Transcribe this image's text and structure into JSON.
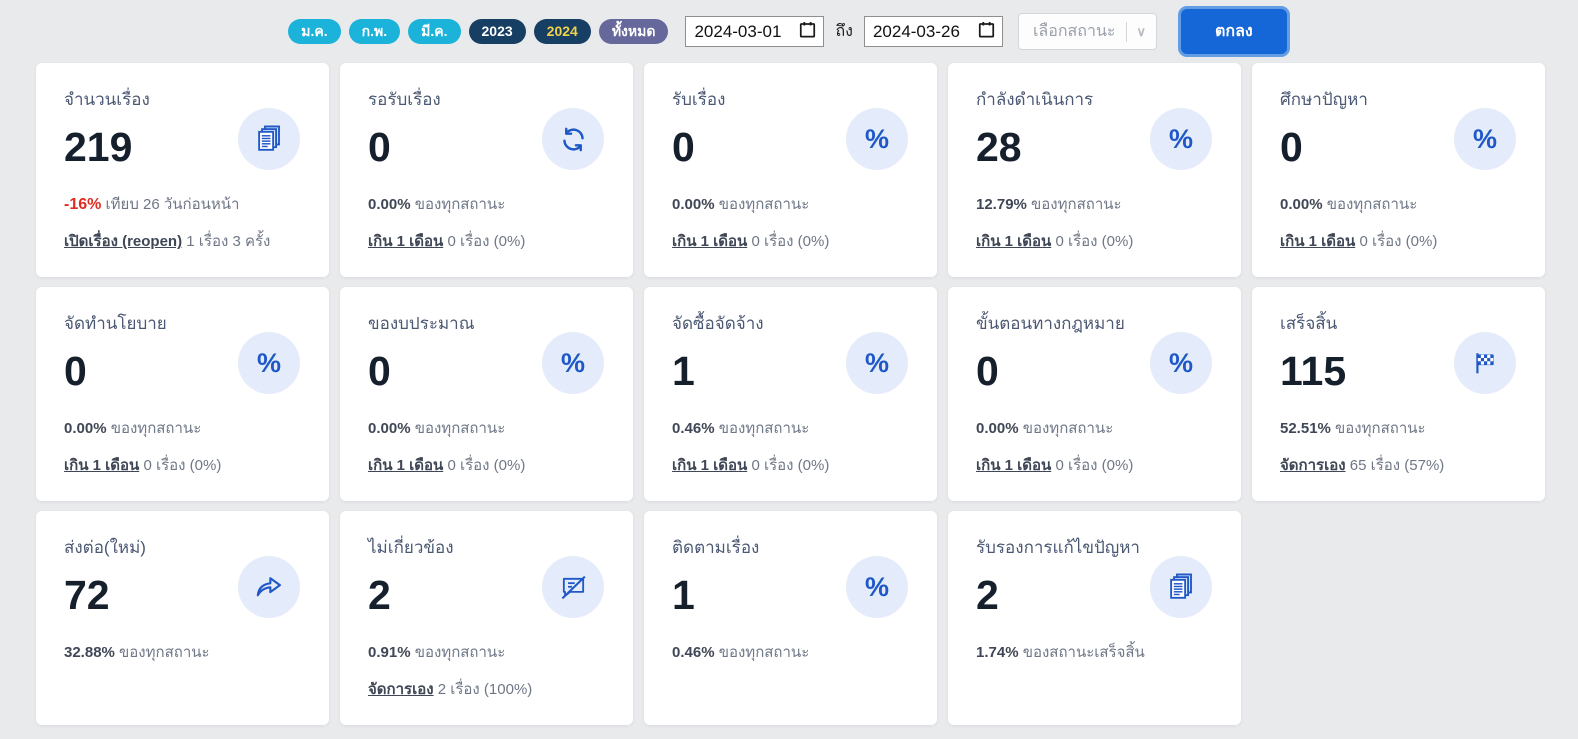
{
  "theme": {
    "page_bg": "#e9eaec",
    "card_bg": "#ffffff",
    "accent_blue": "#2058c8",
    "icon_circle_bg": "#e4ebfa",
    "chip_cyan": "#1cb3da",
    "chip_navy": "#173e63",
    "chip_active_year_text": "#f0d24b",
    "chip_purple": "#66679b",
    "button_blue": "#1566d6",
    "negative_red": "#e02b20"
  },
  "filters": {
    "chips": [
      {
        "label": "ม.ค.",
        "variant": "cyan"
      },
      {
        "label": "ก.พ.",
        "variant": "cyan"
      },
      {
        "label": "มี.ค.",
        "variant": "cyan"
      },
      {
        "label": "2023",
        "variant": "navy"
      },
      {
        "label": "2024",
        "variant": "navy-active"
      },
      {
        "label": "ทั้งหมด",
        "variant": "purple"
      }
    ],
    "date_from": "2024-03-01",
    "to_label": "ถึง",
    "date_to": "2024-03-26",
    "status_placeholder": "เลือกสถานะ",
    "submit_label": "ตกลง"
  },
  "cards": [
    {
      "title": "จำนวนเรื่อง",
      "value": "219",
      "icon": "documents-icon",
      "delta": {
        "value": "-16%",
        "suffix": "เทียบ 26 วันก่อนหน้า"
      },
      "link": {
        "label": "เปิดเรื่อง (reopen)",
        "suffix": "1 เรื่อง 3 ครั้ง"
      }
    },
    {
      "title": "รอรับเรื่อง",
      "value": "0",
      "icon": "refresh-icon",
      "percent": {
        "value": "0.00%",
        "suffix": "ของทุกสถานะ"
      },
      "link": {
        "label": "เกิน 1 เดือน",
        "suffix": "0 เรื่อง (0%)"
      }
    },
    {
      "title": "รับเรื่อง",
      "value": "0",
      "icon": "percent-icon",
      "percent": {
        "value": "0.00%",
        "suffix": "ของทุกสถานะ"
      },
      "link": {
        "label": "เกิน 1 เดือน",
        "suffix": "0 เรื่อง (0%)"
      }
    },
    {
      "title": "กำลังดำเนินการ",
      "value": "28",
      "icon": "percent-icon",
      "percent": {
        "value": "12.79%",
        "suffix": "ของทุกสถานะ"
      },
      "link": {
        "label": "เกิน 1 เดือน",
        "suffix": "0 เรื่อง (0%)"
      }
    },
    {
      "title": "ศึกษาปัญหา",
      "value": "0",
      "icon": "percent-icon",
      "percent": {
        "value": "0.00%",
        "suffix": "ของทุกสถานะ"
      },
      "link": {
        "label": "เกิน 1 เดือน",
        "suffix": "0 เรื่อง (0%)"
      }
    },
    {
      "title": "จัดทำนโยบาย",
      "value": "0",
      "icon": "percent-icon",
      "percent": {
        "value": "0.00%",
        "suffix": "ของทุกสถานะ"
      },
      "link": {
        "label": "เกิน 1 เดือน",
        "suffix": "0 เรื่อง (0%)"
      }
    },
    {
      "title": "ของบประมาณ",
      "value": "0",
      "icon": "percent-icon",
      "percent": {
        "value": "0.00%",
        "suffix": "ของทุกสถานะ"
      },
      "link": {
        "label": "เกิน 1 เดือน",
        "suffix": "0 เรื่อง (0%)"
      }
    },
    {
      "title": "จัดซื้อจัดจ้าง",
      "value": "1",
      "icon": "percent-icon",
      "percent": {
        "value": "0.46%",
        "suffix": "ของทุกสถานะ"
      },
      "link": {
        "label": "เกิน 1 เดือน",
        "suffix": "0 เรื่อง (0%)"
      }
    },
    {
      "title": "ขั้นตอนทางกฎหมาย",
      "value": "0",
      "icon": "percent-icon",
      "percent": {
        "value": "0.00%",
        "suffix": "ของทุกสถานะ"
      },
      "link": {
        "label": "เกิน 1 เดือน",
        "suffix": "0 เรื่อง (0%)"
      }
    },
    {
      "title": "เสร็จสิ้น",
      "value": "115",
      "icon": "flag-icon",
      "percent": {
        "value": "52.51%",
        "suffix": "ของทุกสถานะ"
      },
      "link": {
        "label": "จัดการเอง",
        "suffix": "65 เรื่อง (57%)"
      }
    },
    {
      "title": "ส่งต่อ(ใหม่)",
      "value": "72",
      "icon": "share-icon",
      "percent": {
        "value": "32.88%",
        "suffix": "ของทุกสถานะ"
      }
    },
    {
      "title": "ไม่เกี่ยวข้อง",
      "value": "2",
      "icon": "message-slash-icon",
      "percent": {
        "value": "0.91%",
        "suffix": "ของทุกสถานะ"
      },
      "link": {
        "label": "จัดการเอง",
        "suffix": "2 เรื่อง (100%)"
      }
    },
    {
      "title": "ติดตามเรื่อง",
      "value": "1",
      "icon": "percent-icon",
      "percent": {
        "value": "0.46%",
        "suffix": "ของทุกสถานะ"
      }
    },
    {
      "title": "รับรองการแก้ไขปัญหา",
      "value": "2",
      "icon": "documents-icon",
      "percent": {
        "value": "1.74%",
        "suffix": "ของสถานะเสร็จสิ้น"
      }
    }
  ]
}
